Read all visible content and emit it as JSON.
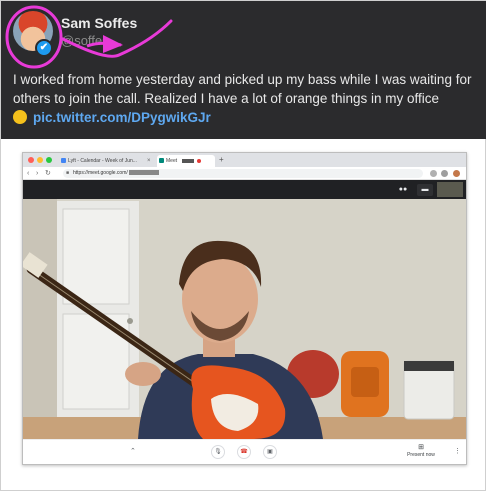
{
  "tweet": {
    "name": "Sam Soffes",
    "handle": "@soffes",
    "text": "I worked from home yesterday and picked up my bass while I was waiting for others to join the call. Realized I have a lot of orange things in my office",
    "link": "pic.twitter.com/DPygwikGJr",
    "verified_glyph": "✔"
  },
  "browser": {
    "tabs": [
      {
        "label": "Lyft - Calendar - Week of Jun..."
      },
      {
        "label": "Meet"
      }
    ],
    "new_tab": "+",
    "address": "https://meet.google.com/",
    "lock_glyph": "🔒"
  },
  "meet": {
    "present_label": "Present now",
    "chevron": "⌃",
    "more": "⋮",
    "people_icon": "👥",
    "chat_icon": "💬"
  },
  "colors": {
    "annotation": "#e83ad8",
    "link": "#5ea8f0",
    "dark_bg": "#2b2b2d",
    "hangup": "#d93025"
  },
  "icons": {
    "verified": "verified-badge-icon",
    "mic": "mic-off-icon",
    "hangup": "hang-up-icon",
    "camera": "camera-off-icon",
    "present": "present-screen-icon"
  }
}
